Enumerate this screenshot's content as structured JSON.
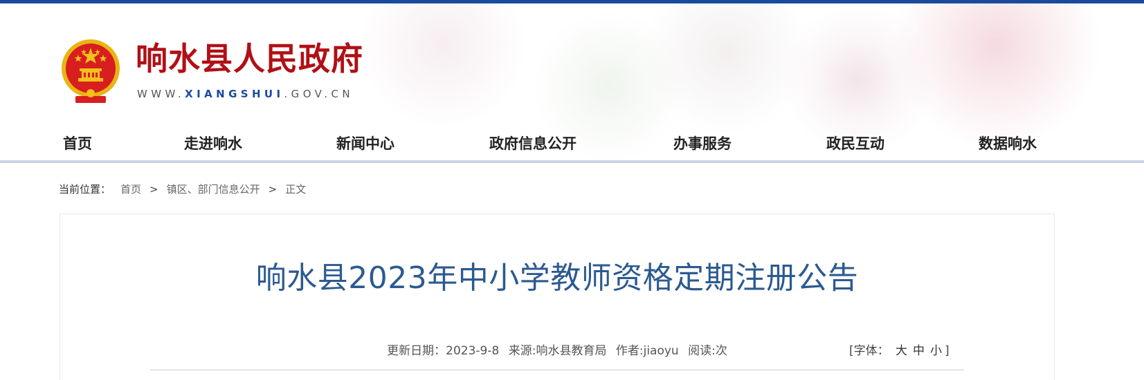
{
  "header": {
    "site_name": "响水县人民政府",
    "url_prefix": "WWW.",
    "url_highlight": "XIANGSHUI",
    "url_suffix": ".GOV.CN"
  },
  "nav": {
    "items": [
      "首页",
      "走进响水",
      "新闻中心",
      "政府信息公开",
      "办事服务",
      "政民互动",
      "数据响水"
    ]
  },
  "breadcrumb": {
    "prefix": "当前位置：",
    "items": [
      "首页",
      "镇区、部门信息公开",
      "正文"
    ],
    "separator": ">"
  },
  "article": {
    "title": "响水县2023年中小学教师资格定期注册公告",
    "meta": {
      "date": "更新日期：2023-9-8",
      "source": "来源:响水县教育局",
      "author": "作者:jiaoyu",
      "reads": "阅读:次"
    },
    "font_size": {
      "label": "[字体：",
      "large": "大",
      "medium": "中",
      "small": "小",
      "close": "]"
    }
  },
  "colors": {
    "top_bar": "#1a4a9c",
    "site_name": "#b01016",
    "article_title": "#2c5a90",
    "emblem_red": "#d81e1e",
    "emblem_gold": "#f2c11c"
  }
}
